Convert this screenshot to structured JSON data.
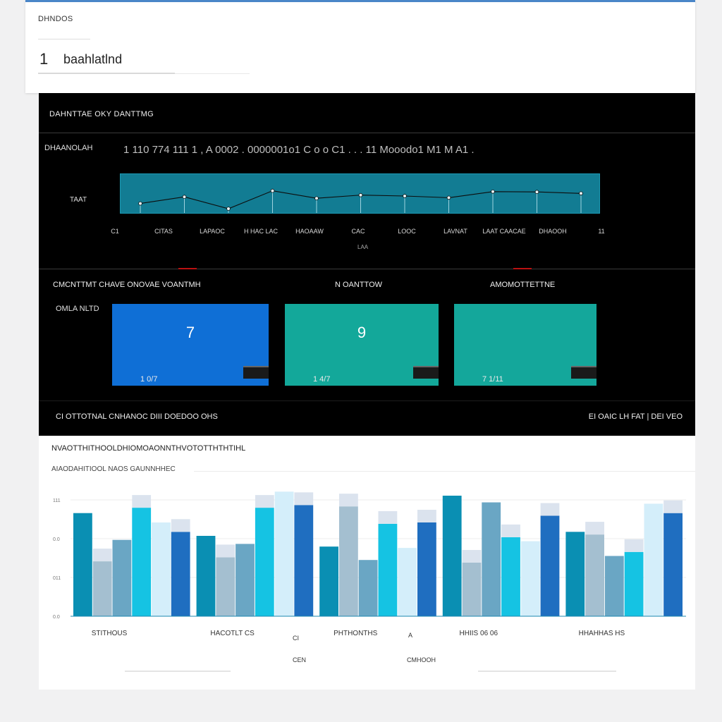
{
  "header": {
    "section_label": "DHNDOS",
    "step_number": "1",
    "title": "baahlatlnd"
  },
  "trend_panel": {
    "header": "DAHNTTAE OKY DANTTMG",
    "row_label": "DHAANOLAH",
    "summary": "1 110 774 111 1 , A 0002 . 0000001o1 C o o C1 . . . 11 Mooodo1 M1 M A1 .",
    "y_unit": "TAAT",
    "x_ticks": [
      "C1",
      "CITAS",
      "LAPAOC",
      "H HAC LAC",
      "HAOAAW",
      "CAC",
      "LOOC",
      "LAVNAT",
      "LAAT CAACAE",
      "DHAOOH",
      "11"
    ],
    "x_axis_title": "LAA",
    "line_points": [
      0.82,
      0.59,
      1.0,
      0.38,
      0.64,
      0.53,
      0.56,
      0.62,
      0.41,
      0.42,
      0.47
    ],
    "line_color": "#0d0d0d",
    "fill_color": "#127c93"
  },
  "kpis": {
    "header_left": "CMCNTTMT CHAVE ONOVAE VOANTMH",
    "header_mid": "N OANTTOW",
    "header_right": "AMOMOTTETTNE",
    "row_label": "OMLA NLTD",
    "cards": [
      {
        "value": "7",
        "caption": "1 0/7",
        "color": "#0f6fd6"
      },
      {
        "value": "9",
        "caption": "1 4/7",
        "color": "#13a89a"
      },
      {
        "value": "",
        "caption": "7 1/11",
        "color": "#14a79b"
      }
    ],
    "footer_left": "CI OTTOTNAL CNHANOC DIII DOEDOO OHS",
    "footer_right": "EI OAIC LH FAT | DEI VEO"
  },
  "bar_chart_card": {
    "title": "NVAOTTHITHOOLDHIOMOAONNTHVOTOTTHTHTIHL",
    "subtitle": "AIAODAHITIOOL NAOS GAUNNHHEC",
    "category_labels": [
      "STITHOUS",
      "HACOTLT CS",
      "PHTHONTHS",
      "HHIIS 06 06",
      "HHAHHAS HS"
    ],
    "note_labels": [
      "CI",
      "A",
      "CEN",
      "CMHOOH"
    ]
  },
  "chart_data": {
    "type": "bar",
    "title": "NVAOTTHITHOOLDHIOMOAONNTHVOTOTTHTHTIHL",
    "xlabel": "",
    "ylabel": "",
    "ylim": [
      0,
      100
    ],
    "y_ticks": [
      "111",
      "0.0",
      "011",
      "0.0"
    ],
    "categories": [
      "STITHOUS",
      "HACOTLT CS",
      "PHTHONTHS",
      "HHIIS 06 06",
      "HHAHHAS HS"
    ],
    "colors": [
      "#0a8fb3",
      "#a4bfd0",
      "#6aa6c4",
      "#15c3e3",
      "#d4eefa",
      "#1f6ec0"
    ],
    "groups": [
      {
        "values": [
          77,
          41,
          57,
          81,
          70,
          63
        ]
      },
      {
        "values": [
          60,
          44,
          54,
          81,
          93,
          83
        ]
      },
      {
        "values": [
          52,
          82,
          42,
          69,
          51,
          70
        ]
      },
      {
        "values": [
          90,
          40,
          85,
          59,
          56,
          75
        ]
      },
      {
        "values": [
          63,
          61,
          45,
          48,
          84,
          77
        ]
      }
    ]
  }
}
